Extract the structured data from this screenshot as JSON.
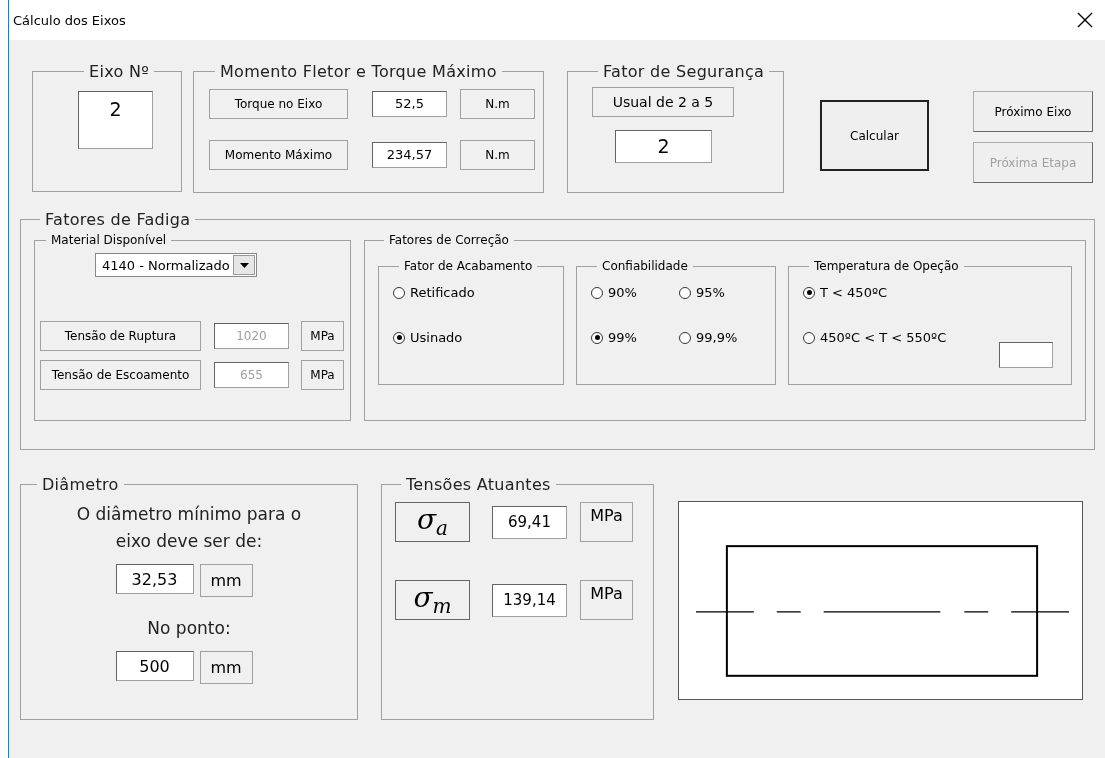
{
  "window": {
    "title": "Cálculo dos Eixos"
  },
  "shaft": {
    "title": "Eixo Nº",
    "value": "2"
  },
  "moments": {
    "title": "Momento Fletor e Torque Máximo",
    "rows": [
      {
        "label": "Torque no Eixo",
        "value": "52,5",
        "unit": "N.m"
      },
      {
        "label": "Momento Máximo",
        "value": "234,57",
        "unit": "N.m"
      }
    ]
  },
  "safety_factor": {
    "title": "Fator de Segurança",
    "hint": "Usual de 2 a 5",
    "value": "2"
  },
  "buttons": [
    {
      "label": "Calcular",
      "kind": "main",
      "disabled": false
    },
    {
      "label": "Próximo Eixo",
      "kind": "side",
      "disabled": false
    },
    {
      "label": "Próxima Etapa",
      "kind": "side",
      "disabled": true
    }
  ],
  "fatigue": {
    "title": "Fatores de Fadiga",
    "material": {
      "title": "Material Disponível",
      "value": "4140 - Normalizado",
      "properties": [
        {
          "label": "Tensão de Ruptura",
          "value": "1020",
          "unit": "MPa",
          "disabled": true
        },
        {
          "label": "Tensão de Escoamento",
          "value": "655",
          "unit": "MPa",
          "disabled": true
        }
      ]
    },
    "correction": {
      "title": "Fatores de Correção",
      "groups": [
        {
          "title": "Fator de Acabamento",
          "extra_field": false,
          "options": [
            {
              "label": "Retificado",
              "selected": false
            },
            {
              "label": "Usinado",
              "selected": true
            }
          ]
        },
        {
          "title": "Confiabilidade",
          "extra_field": false,
          "options": [
            {
              "label": "90%",
              "selected": false
            },
            {
              "label": "95%",
              "selected": false
            },
            {
              "label": "99%",
              "selected": true
            },
            {
              "label": "99,9%",
              "selected": false
            }
          ]
        },
        {
          "title": "Temperatura de Opeção",
          "extra_field": true,
          "options": [
            {
              "label": "T < 450ºC",
              "selected": true
            },
            {
              "label": "450ºC < T < 550ºC",
              "selected": false
            }
          ]
        }
      ]
    }
  },
  "diameter": {
    "title": "Diâmetro",
    "text": "O diâmetro mínimo para o eixo deve ser de:",
    "value": "32,53",
    "unit": "mm",
    "point_label": "No ponto:",
    "point_value": "500",
    "point_unit": "mm"
  },
  "stresses": {
    "title": "Tensões Atuantes",
    "rows": [
      {
        "symbol": "σ$_{a}$",
        "value": "69,41",
        "unit": "MPa"
      },
      {
        "symbol": "σ$_{m}$",
        "value": "139,14",
        "unit": "MPa"
      }
    ]
  }
}
